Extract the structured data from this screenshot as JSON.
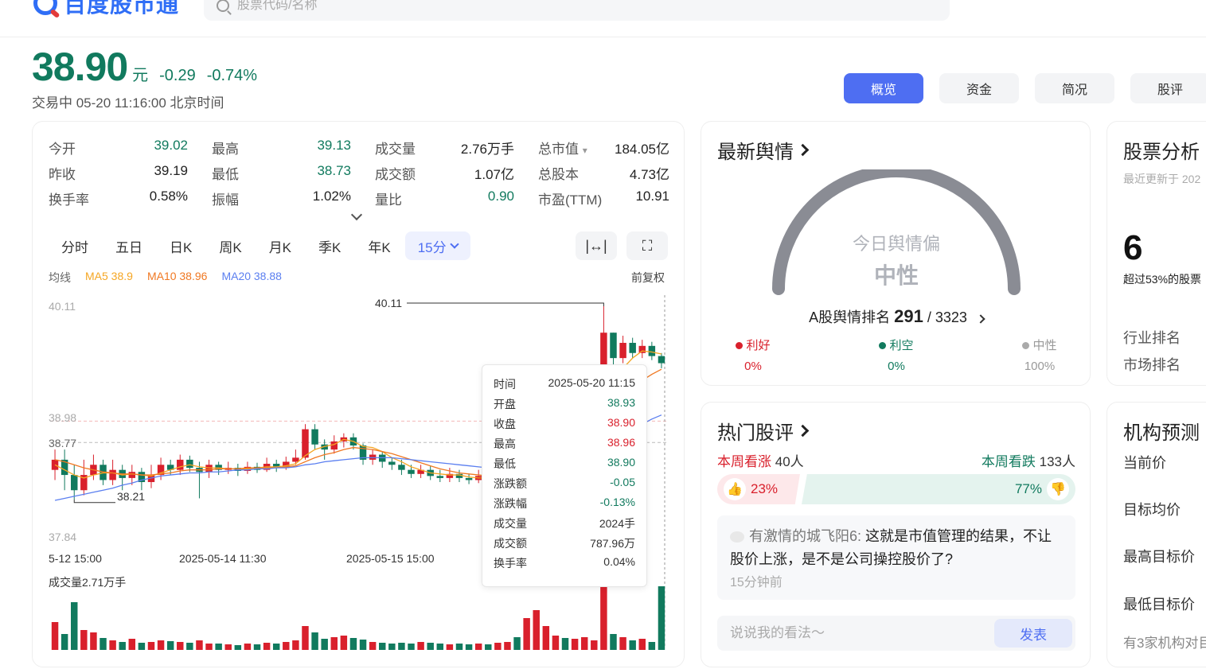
{
  "header": {
    "logo_text": "百度股市通",
    "search_placeholder": "股票代码/名称"
  },
  "price": {
    "current": "38.90",
    "unit": "元",
    "change": "-0.29",
    "change_pct": "-0.74%",
    "status": "交易中 05-20 11:16:00 北京时间"
  },
  "top_tabs": [
    "概览",
    "资金",
    "简况",
    "股评"
  ],
  "stats": [
    [
      {
        "label": "今开",
        "value": "39.02",
        "color": "green"
      },
      {
        "label": "最高",
        "value": "39.13",
        "color": "green"
      },
      {
        "label": "成交量",
        "value": "2.76万手",
        "color": ""
      },
      {
        "label": "总市值",
        "value": "184.05亿",
        "color": ""
      }
    ],
    [
      {
        "label": "昨收",
        "value": "39.19",
        "color": ""
      },
      {
        "label": "最低",
        "value": "38.73",
        "color": "green"
      },
      {
        "label": "成交额",
        "value": "1.07亿",
        "color": ""
      },
      {
        "label": "总股本",
        "value": "4.73亿",
        "color": ""
      }
    ],
    [
      {
        "label": "换手率",
        "value": "0.58%",
        "color": ""
      },
      {
        "label": "振幅",
        "value": "1.02%",
        "color": ""
      },
      {
        "label": "量比",
        "value": "0.90",
        "color": "green"
      },
      {
        "label": "市盈(TTM)",
        "value": "10.91",
        "color": ""
      }
    ]
  ],
  "market_cap_dropdown": "▾",
  "period_tabs": [
    "分时",
    "五日",
    "日K",
    "周K",
    "月K",
    "季K",
    "年K",
    "15分"
  ],
  "ma_legend": {
    "label": "均线",
    "ma5": "MA5 38.9",
    "ma10": "MA10 38.96",
    "ma20": "MA20 38.88"
  },
  "adjust_label": "前复权",
  "chart_labels": {
    "y_top": "40.11",
    "y_mid1": "38.98",
    "y_mid2": "38.77",
    "y_bottom": "37.84",
    "max_annot": "40.11",
    "min_annot": "38.21",
    "x_ticks": [
      "5-12 15:00",
      "2025-05-14 11:30",
      "2025-05-15 15:00"
    ],
    "volume_label": "成交量2.71万手"
  },
  "tooltip": [
    {
      "label": "时间",
      "value": "2025-05-20 11:15",
      "color": ""
    },
    {
      "label": "开盘",
      "value": "38.93",
      "color": "green"
    },
    {
      "label": "收盘",
      "value": "38.90",
      "color": "red"
    },
    {
      "label": "最高",
      "value": "38.96",
      "color": "red"
    },
    {
      "label": "最低",
      "value": "38.90",
      "color": "green"
    },
    {
      "label": "涨跌额",
      "value": "-0.05",
      "color": "green"
    },
    {
      "label": "涨跌幅",
      "value": "-0.13%",
      "color": "green"
    },
    {
      "label": "成交量",
      "value": "2024手",
      "color": ""
    },
    {
      "label": "成交额",
      "value": "787.96万",
      "color": ""
    },
    {
      "label": "换手率",
      "value": "0.04%",
      "color": ""
    }
  ],
  "sentiment": {
    "title": "最新舆情",
    "gauge_title": "今日舆情偏",
    "gauge_value": "中性",
    "rank_prefix": "A股舆情排名",
    "rank": "291",
    "rank_total": "/ 3323",
    "good_label": "利好",
    "good_pct": "0%",
    "bad_label": "利空",
    "bad_pct": "0%",
    "neutral_label": "中性",
    "neutral_pct": "100%"
  },
  "hot": {
    "title": "热门股评",
    "up_label": "本周看涨",
    "up_count": "40人",
    "down_label": "本周看跌",
    "down_count": "133人",
    "up_pct": "23%",
    "down_pct": "77%",
    "comment_user": "有激情的城飞阳6:",
    "comment_text": "这就是市值管理的结果，不让股价上涨，是不是公司操控股价了?",
    "comment_time": "15分钟前",
    "reply_placeholder": "说说我的看法～",
    "post_label": "发表"
  },
  "analysis": {
    "title": "股票分析",
    "updated": "最近更新于 202",
    "score": "6",
    "desc": "超过53%的股票",
    "industry_rank": "行业排名",
    "market_rank": "市场排名"
  },
  "forecast": {
    "title": "机构预测",
    "current_price": "当前价",
    "target_avg": "目标均价",
    "target_high": "最高目标价",
    "target_low": "最低目标价",
    "note": "有3家机构对目"
  },
  "colors": {
    "up": "#d9202c",
    "down": "#117a5e",
    "accent": "#4e6ef2"
  },
  "chart_data": {
    "type": "candlestick",
    "ylim": [
      37.84,
      40.11
    ],
    "candles": [
      [
        38.5,
        38.6,
        38.7,
        38.4
      ],
      [
        38.6,
        38.45,
        38.7,
        38.3
      ],
      [
        38.45,
        38.3,
        38.55,
        38.21
      ],
      [
        38.3,
        38.45,
        38.6,
        38.25
      ],
      [
        38.45,
        38.55,
        38.65,
        38.4
      ],
      [
        38.55,
        38.4,
        38.6,
        38.35
      ],
      [
        38.4,
        38.5,
        38.6,
        38.35
      ],
      [
        38.5,
        38.42,
        38.55,
        38.3
      ],
      [
        38.42,
        38.48,
        38.55,
        38.35
      ],
      [
        38.48,
        38.38,
        38.52,
        38.3
      ],
      [
        38.38,
        38.45,
        38.55,
        38.32
      ],
      [
        38.45,
        38.55,
        38.62,
        38.4
      ],
      [
        38.55,
        38.5,
        38.6,
        38.45
      ],
      [
        38.5,
        38.6,
        38.65,
        38.45
      ],
      [
        38.6,
        38.52,
        38.64,
        38.48
      ],
      [
        38.52,
        38.48,
        38.58,
        38.22
      ],
      [
        38.48,
        38.55,
        38.6,
        38.42
      ],
      [
        38.55,
        38.5,
        38.58,
        38.45
      ],
      [
        38.5,
        38.52,
        38.58,
        38.46
      ],
      [
        38.52,
        38.49,
        38.56,
        38.44
      ],
      [
        38.49,
        38.53,
        38.58,
        38.46
      ],
      [
        38.53,
        38.5,
        38.57,
        38.47
      ],
      [
        38.5,
        38.56,
        38.62,
        38.48
      ],
      [
        38.56,
        38.52,
        38.6,
        38.48
      ],
      [
        38.52,
        38.58,
        38.63,
        38.5
      ],
      [
        38.58,
        38.62,
        38.7,
        38.55
      ],
      [
        38.62,
        38.9,
        38.95,
        38.6
      ],
      [
        38.9,
        38.75,
        38.95,
        38.7
      ],
      [
        38.75,
        38.7,
        38.8,
        38.6
      ],
      [
        38.7,
        38.78,
        38.84,
        38.66
      ],
      [
        38.78,
        38.82,
        38.86,
        38.72
      ],
      [
        38.82,
        38.74,
        38.86,
        38.7
      ],
      [
        38.74,
        38.6,
        38.76,
        38.55
      ],
      [
        38.6,
        38.65,
        38.7,
        38.55
      ],
      [
        38.65,
        38.58,
        38.68,
        38.52
      ],
      [
        38.58,
        38.55,
        38.62,
        38.5
      ],
      [
        38.55,
        38.5,
        38.6,
        38.45
      ],
      [
        38.5,
        38.46,
        38.55,
        38.42
      ],
      [
        38.46,
        38.5,
        38.55,
        38.42
      ],
      [
        38.5,
        38.44,
        38.54,
        38.4
      ],
      [
        38.44,
        38.42,
        38.5,
        38.38
      ],
      [
        38.42,
        38.46,
        38.52,
        38.38
      ],
      [
        38.46,
        38.42,
        38.5,
        38.38
      ],
      [
        38.42,
        38.4,
        38.46,
        38.36
      ],
      [
        38.4,
        38.44,
        38.5,
        38.37
      ],
      [
        38.44,
        38.4,
        38.48,
        38.36
      ],
      [
        38.4,
        38.45,
        38.5,
        38.36
      ],
      [
        38.45,
        38.52,
        38.58,
        38.4
      ],
      [
        38.52,
        38.4,
        38.55,
        38.36
      ],
      [
        38.4,
        38.45,
        38.9,
        38.36
      ],
      [
        38.45,
        39.05,
        39.1,
        38.42
      ],
      [
        39.05,
        38.98,
        39.2,
        38.95
      ],
      [
        38.98,
        39.05,
        39.12,
        38.94
      ],
      [
        39.05,
        39.0,
        39.12,
        38.96
      ],
      [
        39.0,
        39.1,
        39.15,
        38.98
      ],
      [
        39.1,
        39.15,
        39.2,
        39.05
      ],
      [
        39.15,
        39.22,
        39.28,
        39.1
      ],
      [
        39.22,
        39.85,
        40.11,
        39.2
      ],
      [
        39.85,
        39.6,
        39.85,
        39.5
      ],
      [
        39.6,
        39.75,
        39.82,
        39.55
      ],
      [
        39.75,
        39.65,
        39.8,
        39.6
      ],
      [
        39.65,
        39.72,
        39.78,
        39.6
      ],
      [
        39.72,
        39.62,
        39.76,
        39.58
      ],
      [
        39.62,
        39.55,
        39.65,
        39.5
      ]
    ],
    "volumes": [
      [
        35,
        "red"
      ],
      [
        20,
        "green"
      ],
      [
        60,
        "green"
      ],
      [
        25,
        "red"
      ],
      [
        22,
        "red"
      ],
      [
        15,
        "green"
      ],
      [
        12,
        "red"
      ],
      [
        10,
        "green"
      ],
      [
        14,
        "red"
      ],
      [
        9,
        "green"
      ],
      [
        10,
        "red"
      ],
      [
        12,
        "red"
      ],
      [
        11,
        "green"
      ],
      [
        10,
        "red"
      ],
      [
        9,
        "green"
      ],
      [
        12,
        "red"
      ],
      [
        8,
        "red"
      ],
      [
        8,
        "green"
      ],
      [
        7,
        "red"
      ],
      [
        6,
        "green"
      ],
      [
        8,
        "red"
      ],
      [
        7,
        "green"
      ],
      [
        9,
        "red"
      ],
      [
        8,
        "green"
      ],
      [
        10,
        "red"
      ],
      [
        12,
        "red"
      ],
      [
        30,
        "red"
      ],
      [
        22,
        "green"
      ],
      [
        14,
        "green"
      ],
      [
        16,
        "red"
      ],
      [
        18,
        "red"
      ],
      [
        15,
        "green"
      ],
      [
        13,
        "green"
      ],
      [
        10,
        "red"
      ],
      [
        9,
        "green"
      ],
      [
        8,
        "green"
      ],
      [
        9,
        "green"
      ],
      [
        8,
        "green"
      ],
      [
        10,
        "red"
      ],
      [
        9,
        "green"
      ],
      [
        8,
        "green"
      ],
      [
        7,
        "red"
      ],
      [
        8,
        "green"
      ],
      [
        7,
        "green"
      ],
      [
        8,
        "red"
      ],
      [
        7,
        "green"
      ],
      [
        9,
        "red"
      ],
      [
        10,
        "red"
      ],
      [
        16,
        "green"
      ],
      [
        40,
        "red"
      ],
      [
        50,
        "red"
      ],
      [
        30,
        "red"
      ],
      [
        18,
        "red"
      ],
      [
        15,
        "green"
      ],
      [
        14,
        "red"
      ],
      [
        16,
        "red"
      ],
      [
        12,
        "red"
      ],
      [
        80,
        "red"
      ],
      [
        20,
        "green"
      ],
      [
        16,
        "red"
      ],
      [
        12,
        "green"
      ],
      [
        14,
        "red"
      ],
      [
        10,
        "green"
      ],
      [
        80,
        "green"
      ]
    ],
    "ma_lines": {
      "ma5": [
        38.55,
        38.5,
        38.45,
        38.42,
        38.45,
        38.47,
        38.47,
        38.45,
        38.46,
        38.45,
        38.44,
        38.47,
        38.5,
        38.53,
        38.55,
        38.53,
        38.52,
        38.52,
        38.51,
        38.51,
        38.51,
        38.52,
        38.53,
        38.53,
        38.54,
        38.56,
        38.64,
        38.7,
        38.73,
        38.75,
        38.8,
        38.78,
        38.73,
        38.72,
        38.68,
        38.62,
        38.58,
        38.53,
        38.5,
        38.47,
        38.46,
        38.45,
        38.45,
        38.43,
        38.42,
        38.42,
        38.43,
        38.45,
        38.45,
        38.45,
        38.57,
        38.68,
        38.81,
        38.93,
        39.03,
        39.06,
        39.1,
        39.27,
        39.4,
        39.5,
        39.6,
        39.67,
        39.66,
        39.64
      ],
      "ma10": [
        38.6,
        38.58,
        38.55,
        38.52,
        38.5,
        38.48,
        38.47,
        38.46,
        38.46,
        38.45,
        38.45,
        38.46,
        38.47,
        38.49,
        38.5,
        38.5,
        38.5,
        38.51,
        38.51,
        38.51,
        38.52,
        38.52,
        38.52,
        38.52,
        38.53,
        38.54,
        38.58,
        38.62,
        38.65,
        38.67,
        38.7,
        38.72,
        38.71,
        38.7,
        38.68,
        38.66,
        38.63,
        38.6,
        38.57,
        38.54,
        38.51,
        38.49,
        38.47,
        38.46,
        38.45,
        38.44,
        38.44,
        38.44,
        38.44,
        38.44,
        38.5,
        38.56,
        38.62,
        38.68,
        38.74,
        38.8,
        38.86,
        38.98,
        39.1,
        39.2,
        39.3,
        39.38,
        39.44,
        39.49
      ],
      "ma20": [
        38.2,
        38.22,
        38.24,
        38.26,
        38.28,
        38.3,
        38.32,
        38.35,
        38.37,
        38.4,
        38.42,
        38.44,
        38.45,
        38.46,
        38.47,
        38.47,
        38.48,
        38.48,
        38.49,
        38.5,
        38.5,
        38.51,
        38.51,
        38.52,
        38.52,
        38.53,
        38.55,
        38.56,
        38.58,
        38.59,
        38.6,
        38.61,
        38.62,
        38.62,
        38.62,
        38.62,
        38.61,
        38.6,
        38.59,
        38.58,
        38.57,
        38.56,
        38.55,
        38.54,
        38.53,
        38.52,
        38.51,
        38.5,
        38.49,
        38.48,
        38.5,
        38.52,
        38.55,
        38.58,
        38.6,
        38.63,
        38.66,
        38.72,
        38.78,
        38.84,
        38.9,
        38.95,
        39.0,
        39.04
      ]
    }
  }
}
